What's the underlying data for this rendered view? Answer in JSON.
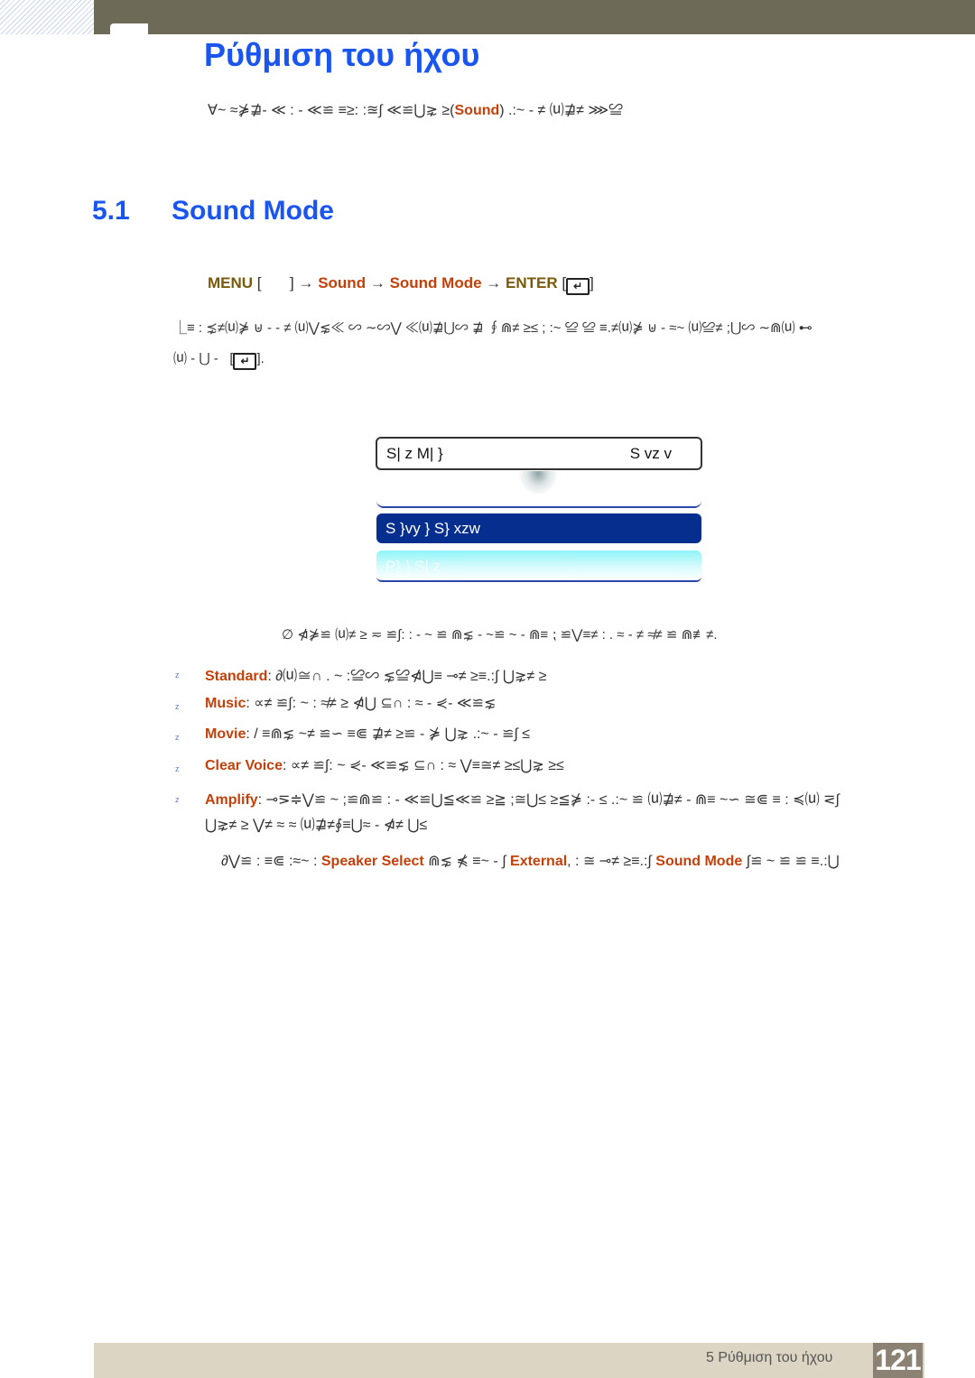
{
  "header": {
    "chapter_title": "Ρύθμιση του ήχου",
    "intro_prefix": "∀~ ≈⋡⋣- ≪   : - ≪≌ ≡≥: :≊∫   ≪≌⋃⋧ ≥(",
    "intro_highlight": "Sound",
    "intro_suffix": ")  .:~ - ≠ ⒰⋣≠ ⋙≌"
  },
  "section": {
    "number": "5.1",
    "title": "Sound Mode"
  },
  "menu_path": {
    "menu": "MENU",
    "open_bracket": "[",
    "close_bracket": "]",
    "arrow": "→",
    "sound": "Sound",
    "sound_mode": "Sound Mode",
    "enter": "ENTER",
    "enter_icon": "enter-icon"
  },
  "description": {
    "line1": "⎿≡ :   ⋨≠⒰⋡ ⊎ -   - ≠   ⒰⋁⋦≪ ∽  ∼∽⋁ ≪⒰⋣⋃∽ ⋣ ∮⋒≠ ≥≤ ; :~ ≌    ≌ ≡.≠⒰⋡ ⊎   -    ≈~   ⒰≌≠ ;⋃∽  ∼⋒⒰  ⊷",
    "line2": "⒰ - ⋃ -",
    "line2_end": "]."
  },
  "osd": {
    "label": "S| z  M| }",
    "value": "S vz v",
    "selected_option": "S }vy }  S}  xzw",
    "faded_option": "P} }  S| z"
  },
  "note": "∅  ⋪⋡≌  ⒰≠ ≥   ≂    ≌∫: : -    ~ ≌ ⋒⋦ -   ~≌      ~ - ⋒≡  ⁏   ≌⋁≡≠ : .    ≈  - ≠   ≉≠ ≌ ⋒≢≠.",
  "modes": [
    {
      "name": "Standard",
      "description": "∂⒰≅∩ . ~  :≌∽  ⋦≌⋪⋃≡   ⊸≠ ≥≡.:∫   ⋃⋧≠ ≥"
    },
    {
      "name": "Music",
      "description": "∝≠ ≌∫: ~  :  ≉≠ ≥   ⋪⋃        ⊆∩   :  ≈  -  ⋞- ≪≌⋦"
    },
    {
      "name": "Movie",
      "description": "/    ≡⋒⋦  ~≠ ≌∽ ≡⋐   ⋣≠     ≥≌ - ⋡ ⋃⋧  .:~ -    ≌∫ ≤"
    },
    {
      "name": "Clear Voice",
      "description": "∝≠ ≌∫: ~  ⋞- ≪≌⋦          ⊆∩   :  ≈    ⋁≡≅≠ ≥≤⋃⋧ ≥≤"
    },
    {
      "name": "Amplify",
      "description": "⊸⋝≑⋁≌  ~  ;≌⋒≌      : - ≪≌⋃≦≪≌ ≥≧ ;≅⋃≤    ≥≦⋡ :-    ≤ .:~  ≌  ⒰⋣≠   - ⋒≡  ~∽ ≅⋐   ≡ :    ≼⒰  ⋜∫",
      "continuation": "⋃⋧≠ ≥        ⋁≠ ≈     ≈  ⒰⋣≠∮≡⋃≈  -         ⋪≠ ⋃≤"
    }
  ],
  "footnote": {
    "prefix": "∂⋁≌ :  ≡⋐ :≈~  :",
    "speaker_select": "Speaker Select",
    "middle": " ⋒⋦  ⋠ ≡~ -   ∫     ",
    "external": "External",
    "middle2": ",   : ≅   ⊸≠ ≥≡.:∫ ",
    "sound_mode": "Sound Mode",
    "suffix": "  ∫≌  ~  ≌ ≌  ≡.:⋃"
  },
  "footer": {
    "chapter_label": "5 Ρύθμιση του ήχου",
    "page_number": "121"
  },
  "colors": {
    "title_blue": "#1a55f0",
    "keyword_orange": "#c4400a",
    "menu_olive": "#7a5a0a",
    "osd_selected": "#062e8f",
    "header_bar": "#6d6b58",
    "footer_bar": "#dcd5c3",
    "page_box": "#8c8273"
  }
}
